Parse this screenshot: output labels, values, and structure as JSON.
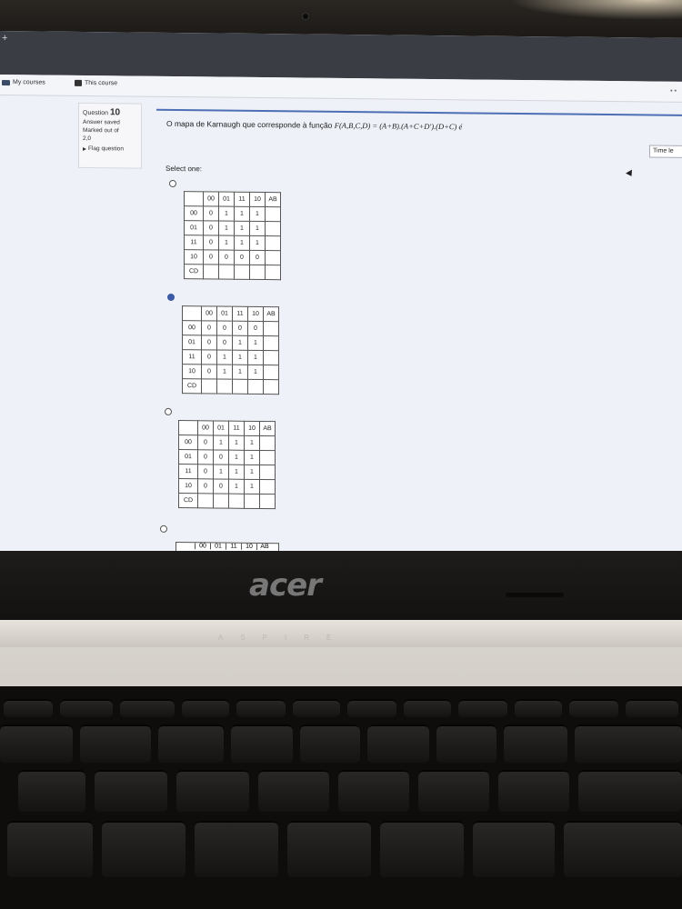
{
  "nav": {
    "my_courses": "My courses",
    "this_course": "This course"
  },
  "info": {
    "question_label": "Question",
    "question_number": "10",
    "status": "Answer saved",
    "marked_out_of": "Marked out of",
    "marks": "2,0",
    "flag": "Flag question"
  },
  "question": {
    "text_prefix": "O mapa de Karnaugh que corresponde à função ",
    "function": "F(A,B,C,D) = (A+B).(A+C+D').(D+C) é"
  },
  "timer": {
    "label": "Time le"
  },
  "select_label": "Select one:",
  "options": [
    {
      "selected": false,
      "cols": [
        "00",
        "01",
        "11",
        "10",
        "AB"
      ],
      "rows": [
        [
          "00",
          "0",
          "1",
          "1",
          "1"
        ],
        [
          "01",
          "0",
          "1",
          "1",
          "1"
        ],
        [
          "11",
          "0",
          "1",
          "1",
          "1"
        ],
        [
          "10",
          "0",
          "0",
          "0",
          "0"
        ]
      ],
      "footer": "CD"
    },
    {
      "selected": true,
      "cols": [
        "00",
        "01",
        "11",
        "10",
        "AB"
      ],
      "rows": [
        [
          "00",
          "0",
          "0",
          "0",
          "0"
        ],
        [
          "01",
          "0",
          "0",
          "1",
          "1"
        ],
        [
          "11",
          "0",
          "1",
          "1",
          "1"
        ],
        [
          "10",
          "0",
          "1",
          "1",
          "1"
        ]
      ],
      "footer": "CD"
    },
    {
      "selected": false,
      "cols": [
        "00",
        "01",
        "11",
        "10",
        "AB"
      ],
      "rows": [
        [
          "00",
          "0",
          "1",
          "1",
          "1"
        ],
        [
          "01",
          "0",
          "0",
          "1",
          "1"
        ],
        [
          "11",
          "0",
          "1",
          "1",
          "1"
        ],
        [
          "10",
          "0",
          "0",
          "1",
          "1"
        ]
      ],
      "footer": "CD"
    },
    {
      "selected": false,
      "cols": [
        "00",
        "01",
        "11",
        "10",
        "AB"
      ]
    }
  ],
  "laptop": {
    "brand": "acer",
    "model": "ASPIRE"
  }
}
